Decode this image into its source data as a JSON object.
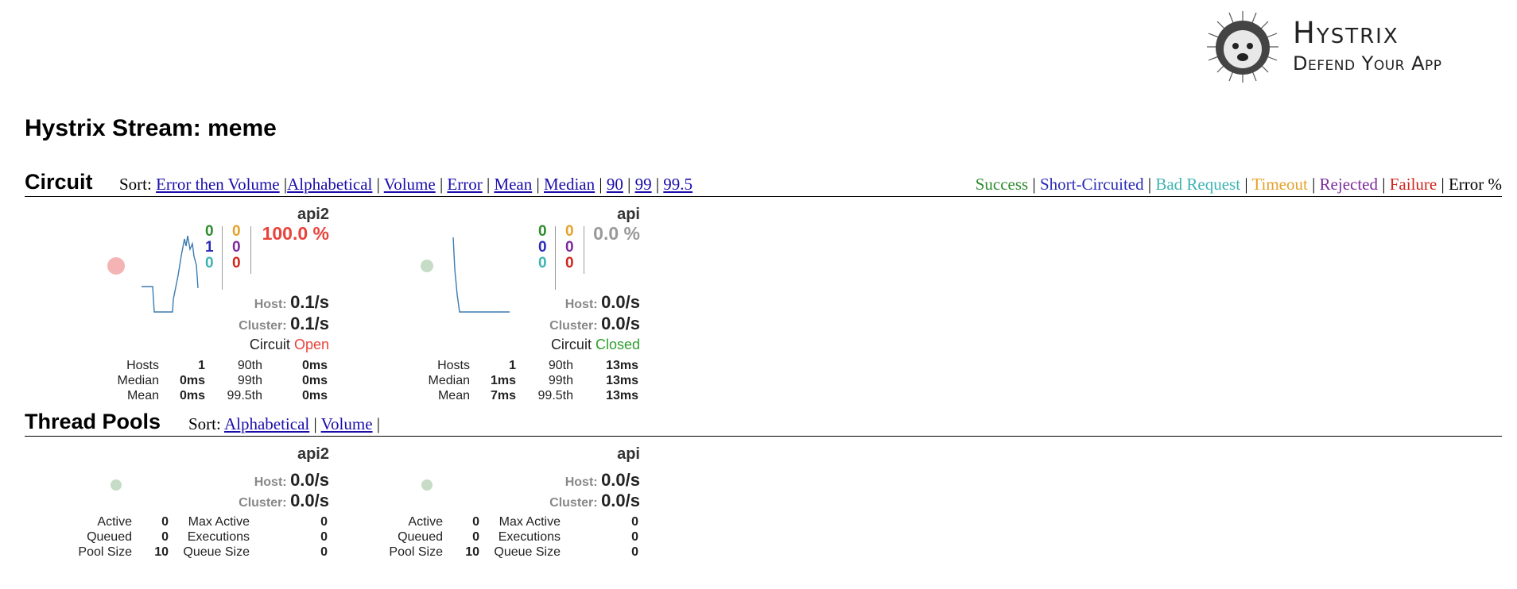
{
  "logo": {
    "title": "Hystrix",
    "subtitle": "Defend Your App"
  },
  "page_title": "Hystrix Stream: meme",
  "colors": {
    "success": "#2e8b2e",
    "short_circuited": "#2b2bb8",
    "bad_request": "#3fb3b3",
    "timeout": "#e5a22b",
    "rejected": "#7d2b9b",
    "failure": "#d0261d",
    "link": "#1a0dab",
    "health_open": "#f4b4b4",
    "health_closed": "#c6dcc6"
  },
  "circuit": {
    "title": "Circuit",
    "sort_label": "Sort:",
    "sort_options": [
      "Error then Volume",
      "Alphabetical",
      "Volume",
      "Error",
      "Mean",
      "Median",
      "90",
      "99",
      "99.5"
    ],
    "legend": [
      "Success",
      "Short-Circuited",
      "Bad Request",
      "Timeout",
      "Rejected",
      "Failure",
      "Error %"
    ],
    "monitors": [
      {
        "name": "api2",
        "counts": {
          "success": "0",
          "short_circuited": "1",
          "bad_request": "0",
          "timeout": "0",
          "rejected": "0",
          "failure": "0"
        },
        "error_pct": "100.0 %",
        "host_label": "Host:",
        "host_rate": "0.1/s",
        "cluster_label": "Cluster:",
        "cluster_rate": "0.1/s",
        "circuit_label": "Circuit",
        "circuit_status": "Open",
        "health": "open",
        "stats": [
          [
            "Hosts",
            "1",
            "90th",
            "0ms"
          ],
          [
            "Median",
            "0ms",
            "99th",
            "0ms"
          ],
          [
            "Mean",
            "0ms",
            "99.5th",
            "0ms"
          ]
        ]
      },
      {
        "name": "api",
        "counts": {
          "success": "0",
          "short_circuited": "0",
          "bad_request": "0",
          "timeout": "0",
          "rejected": "0",
          "failure": "0"
        },
        "error_pct": "0.0 %",
        "host_label": "Host:",
        "host_rate": "0.0/s",
        "cluster_label": "Cluster:",
        "cluster_rate": "0.0/s",
        "circuit_label": "Circuit",
        "circuit_status": "Closed",
        "health": "closed",
        "stats": [
          [
            "Hosts",
            "1",
            "90th",
            "13ms"
          ],
          [
            "Median",
            "1ms",
            "99th",
            "13ms"
          ],
          [
            "Mean",
            "7ms",
            "99.5th",
            "13ms"
          ]
        ]
      }
    ]
  },
  "thread_pools": {
    "title": "Thread Pools",
    "sort_label": "Sort:",
    "sort_options": [
      "Alphabetical",
      "Volume"
    ],
    "pools": [
      {
        "name": "api2",
        "host_label": "Host:",
        "host_rate": "0.0/s",
        "cluster_label": "Cluster:",
        "cluster_rate": "0.0/s",
        "stats": [
          [
            "Active",
            "0",
            "Max Active",
            "0"
          ],
          [
            "Queued",
            "0",
            "Executions",
            "0"
          ],
          [
            "Pool Size",
            "10",
            "Queue Size",
            "0"
          ]
        ]
      },
      {
        "name": "api",
        "host_label": "Host:",
        "host_rate": "0.0/s",
        "cluster_label": "Cluster:",
        "cluster_rate": "0.0/s",
        "stats": [
          [
            "Active",
            "0",
            "Max Active",
            "0"
          ],
          [
            "Queued",
            "0",
            "Executions",
            "0"
          ],
          [
            "Pool Size",
            "10",
            "Queue Size",
            "0"
          ]
        ]
      }
    ]
  }
}
